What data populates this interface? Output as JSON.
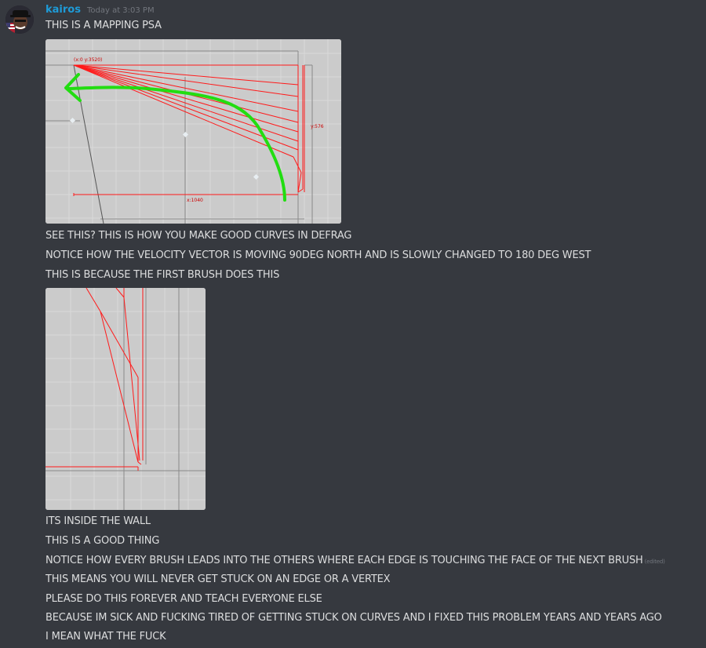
{
  "message": {
    "username": "kairos",
    "timestamp": "Today at 3:03 PM",
    "lines": [
      "THIS IS A MAPPING PSA",
      "SEE THIS? THIS IS HOW YOU MAKE GOOD CURVES IN DEFRAG",
      "NOTICE HOW THE VELOCITY VECTOR IS MOVING 90DEG NORTH AND IS SLOWLY CHANGED TO 180 DEG WEST",
      "THIS IS BECAUSE THE FIRST BRUSH DOES THIS",
      "ITS INSIDE THE WALL",
      "THIS IS A GOOD THING",
      "NOTICE HOW EVERY BRUSH LEADS INTO THE OTHERS WHERE EACH EDGE IS TOUCHING THE FACE OF THE NEXT BRUSH",
      "THIS MEANS YOU WILL NEVER GET STUCK ON AN EDGE OR A VERTEX",
      "PLEASE DO THIS FOREVER AND TEACH EVERYONE ELSE",
      "BECAUSE IM SICK AND FUCKING TIRED OF GETTING STUCK ON CURVES AND I FIXED THIS PROBLEM YEARS AND YEARS AGO",
      "I MEAN WHAT THE FUCK"
    ],
    "edited_label": "(edited)"
  },
  "attachment1": {
    "coord_label": "(x:0  y:3520)",
    "y_label": "y:576",
    "x_label": "x:1040"
  },
  "colors": {
    "background": "#36393f",
    "username": "#1e9bd7",
    "text": "#dcddde",
    "muted": "#72767d",
    "brush_red": "#ff1a1a",
    "arrow_green": "#22dd11",
    "grid_bg": "#cbcbcb"
  }
}
